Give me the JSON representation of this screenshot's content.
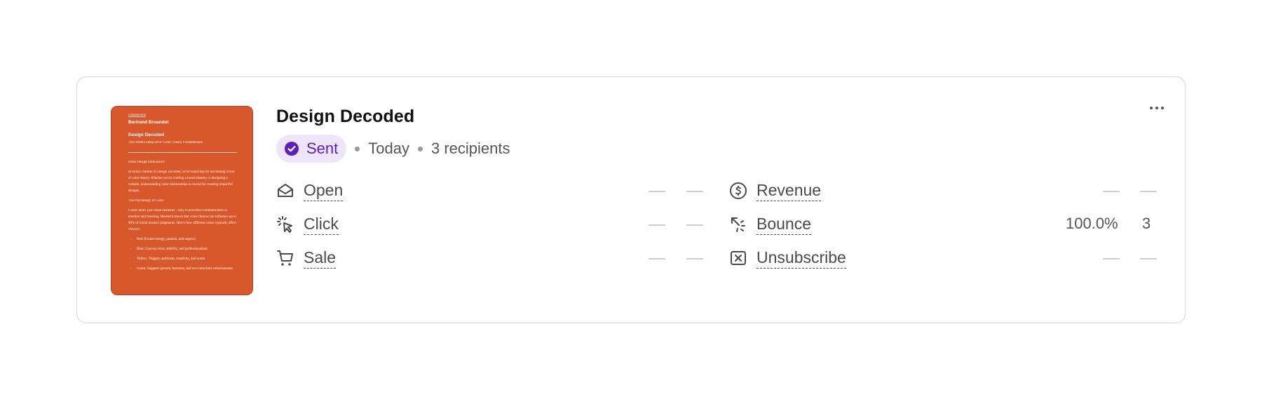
{
  "campaign": {
    "title": "Design Decoded",
    "status": "Sent",
    "date": "Today",
    "recipients": "3 recipients"
  },
  "preview": {
    "small_link": "Unsubscribe",
    "author": "Bertrand Bruandet",
    "newsletter": "Design Decoded",
    "subtitle": "This Week's Deep Dive: Color Theory Fundamentals",
    "greeting": "Hello Design Enthusiasts!",
    "intro": "In today's edition of Design Decoded, we're exploring the fascinating world of color theory. Whether you're crafting a brand identity or designing a website, understanding color relationships is crucial for creating impactful designs.",
    "section_heading": "The Psychology of Color",
    "section_text": "Colors aren't just visual elements – they're powerful communicators of emotion and meaning. Research shows that color choices can influence up to 90% of initial product judgments. Here's how different colors typically affect viewers:",
    "bullets": [
      "Red: Evokes energy, passion, and urgency",
      "Blue: Conveys trust, stability, and professionalism",
      "Yellow: Triggers optimism, creativity, and youth",
      "Green: Suggests growth, harmony, and eco-conscious consciousness"
    ]
  },
  "metrics_left": [
    {
      "label": "Open",
      "icon": "envelope-open-icon",
      "percent": "—",
      "count": "—"
    },
    {
      "label": "Click",
      "icon": "cursor-click-icon",
      "percent": "—",
      "count": "—"
    },
    {
      "label": "Sale",
      "icon": "cart-icon",
      "percent": "—",
      "count": "—"
    }
  ],
  "metrics_right": [
    {
      "label": "Revenue",
      "icon": "dollar-circle-icon",
      "percent": "—",
      "count": "—"
    },
    {
      "label": "Bounce",
      "icon": "bounce-arrow-icon",
      "percent": "100.0%",
      "count": "3"
    },
    {
      "label": "Unsubscribe",
      "icon": "x-square-icon",
      "percent": "—",
      "count": "—"
    }
  ],
  "colors": {
    "accent_purple": "#5b21b6",
    "badge_bg": "#ede6fb",
    "thumbnail_orange": "#d9582b"
  }
}
